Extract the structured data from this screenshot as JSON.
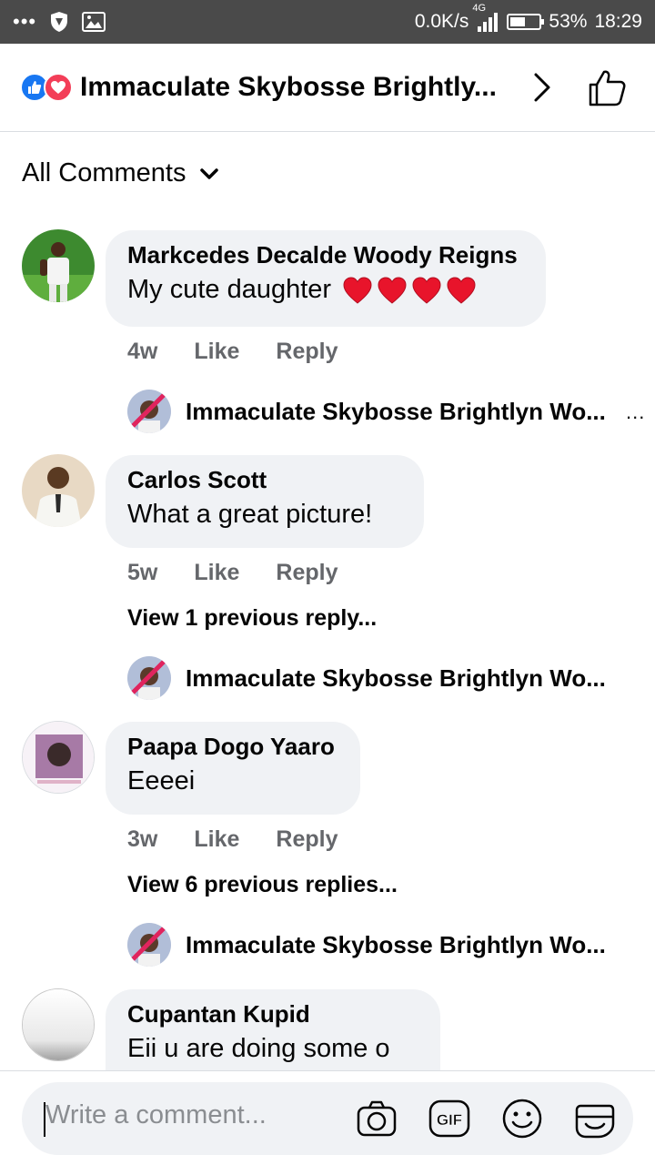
{
  "status_bar": {
    "speed": "0.0K/s",
    "network": "4G",
    "battery_percent": "53%",
    "battery_level": 0.53,
    "time": "18:29"
  },
  "header": {
    "title": "Immaculate Skybosse Brightly...",
    "reactions": [
      "like-icon",
      "love-icon"
    ]
  },
  "filter": {
    "label": "All Comments"
  },
  "comments": [
    {
      "author": "Markcedes Decalde Woody Reigns",
      "text": "My cute daughter",
      "hearts": 4,
      "time": "4w",
      "like": "Like",
      "reply": "Reply",
      "reply_author": "Immaculate Skybosse Brightlyn Wo...",
      "reply_more": "..."
    },
    {
      "author": "Carlos Scott",
      "text": "What a great picture!",
      "time": "5w",
      "like": "Like",
      "reply": "Reply",
      "previous": "View 1 previous reply...",
      "reply_author": "Immaculate Skybosse Brightlyn Wo..."
    },
    {
      "author": "Paapa Dogo Yaaro",
      "text": "Eeeei",
      "time": "3w",
      "like": "Like",
      "reply": "Reply",
      "previous": "View 6 previous replies...",
      "reply_author": "Immaculate Skybosse Brightlyn Wo..."
    },
    {
      "author": "Cupantan Kupid",
      "text": "Eii u are doing some o"
    }
  ],
  "composer": {
    "placeholder": "Write a comment...",
    "icons": [
      "camera-icon",
      "gif-icon",
      "emoji-icon",
      "sticker-icon"
    ]
  },
  "colors": {
    "status_bar": "#4a4a4a",
    "bubble": "#f0f2f5",
    "like_blue": "#1877f2",
    "love_red": "#f33e58",
    "meta_gray": "#65676b"
  }
}
